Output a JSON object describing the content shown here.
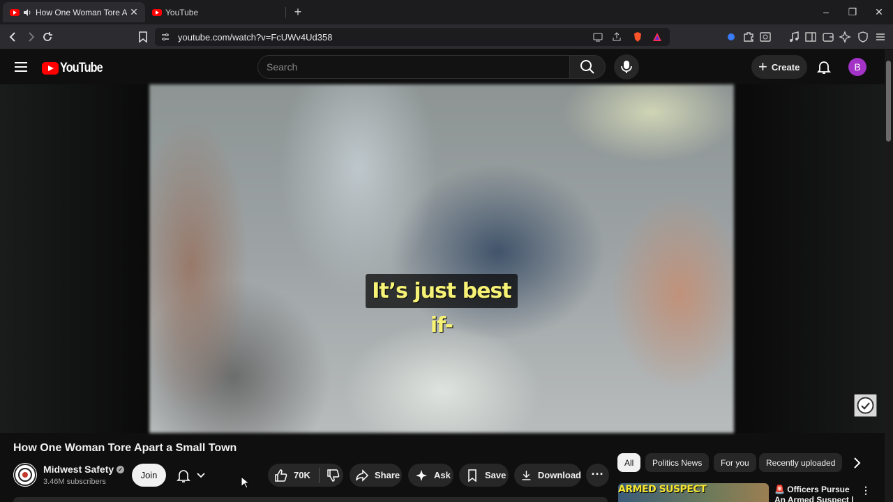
{
  "browser": {
    "tabs": [
      {
        "title": "How One Woman Tore Apart a Small Town",
        "active": true
      },
      {
        "title": "YouTube",
        "active": false
      }
    ],
    "url": "youtube.com/watch?v=FcUWv4Ud358"
  },
  "header": {
    "logo_text": "YouTube",
    "search_placeholder": "Search",
    "create_label": "Create",
    "avatar_letter": "B",
    "avatar_color": "#a233c6"
  },
  "player": {
    "caption": "It’s just best if-"
  },
  "video": {
    "title": "How One Woman Tore Apart a Small Town",
    "channel": "Midwest Safety",
    "subscribers": "3.46M subscribers",
    "join_label": "Join",
    "like_count": "70K",
    "share_label": "Share",
    "ask_label": "Ask",
    "save_label": "Save",
    "download_label": "Download"
  },
  "chips": [
    "All",
    "Politics News",
    "For you",
    "Recently uploaded"
  ],
  "recommendation": {
    "thumb_text_1": "ARMED",
    "thumb_text_2": "SUSPECT",
    "title": "Officers Pursue An Armed Suspect | Cop..."
  },
  "colors": {
    "accent": "#ff0000",
    "caption_text": "#f6f276",
    "background": "#0f0f0f"
  }
}
